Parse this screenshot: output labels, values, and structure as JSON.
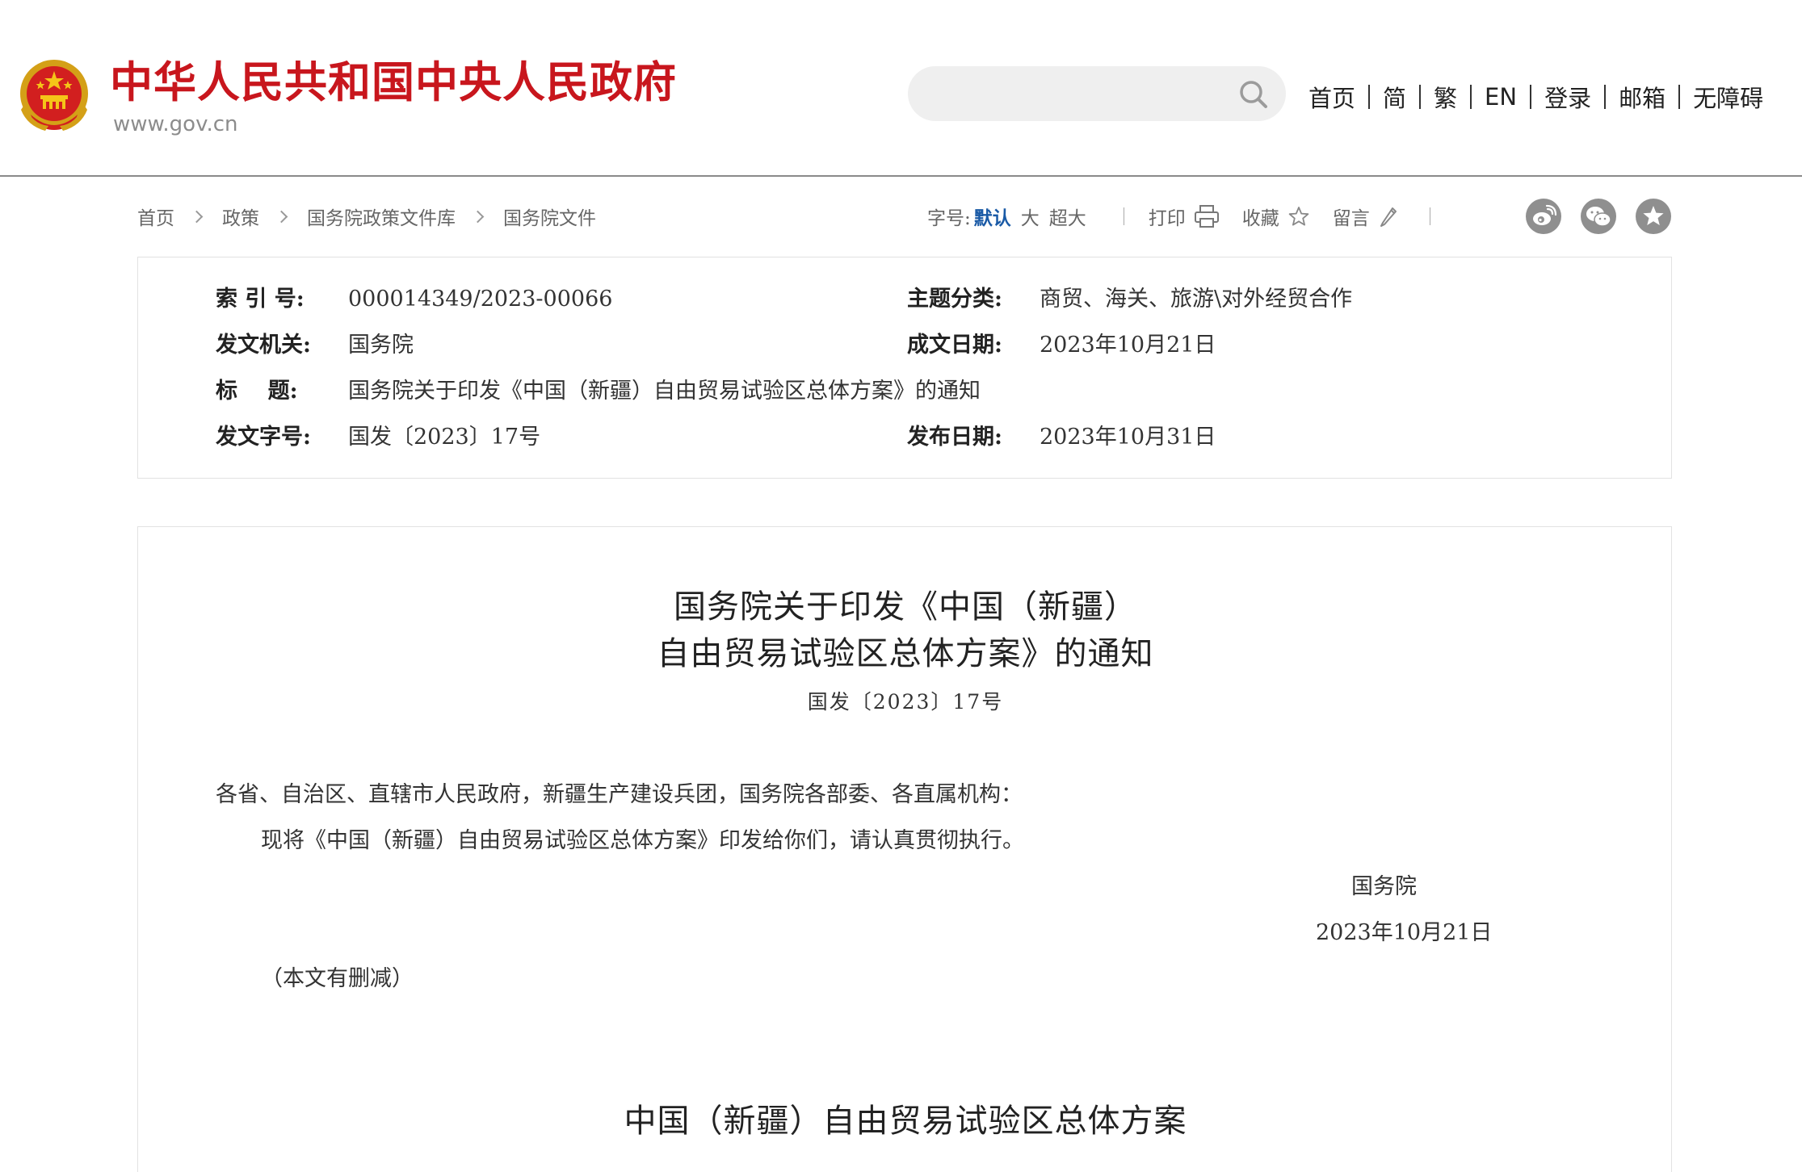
{
  "header": {
    "site_title": "中华人民共和国中央人民政府",
    "site_url": "www.gov.cn",
    "search_placeholder": "",
    "nav": [
      "首页",
      "简",
      "繁",
      "EN",
      "登录",
      "邮箱",
      "无障碍"
    ],
    "brand_color": "#c8161d"
  },
  "breadcrumb": [
    "首页",
    "政策",
    "国务院政策文件库",
    "国务院文件"
  ],
  "toolbar": {
    "font_size_label": "字号:",
    "font_size_options": [
      "默认",
      "大",
      "超大"
    ],
    "print": "打印",
    "favorite": "收藏",
    "comment": "留言",
    "share_icons": [
      "weibo-icon",
      "wechat-icon",
      "star-icon"
    ]
  },
  "info": {
    "index_no": {
      "label": "索 引 号:",
      "value": "000014349/2023-00066"
    },
    "issuer": {
      "label": "发文机关:",
      "value": "国务院"
    },
    "title": {
      "label": "标    题:",
      "value": "国务院关于印发《中国（新疆）自由贸易试验区总体方案》的通知"
    },
    "doc_no": {
      "label": "发文字号:",
      "value": "国发〔2023〕17号"
    },
    "category": {
      "label": "主题分类:",
      "value": "商贸、海关、旅游\\对外经贸合作"
    },
    "written_date": {
      "label": "成文日期:",
      "value": "2023年10月21日"
    },
    "publish_date": {
      "label": "发布日期:",
      "value": "2023年10月31日"
    }
  },
  "article": {
    "title_line1": "国务院关于印发《中国（新疆）",
    "title_line2": "自由贸易试验区总体方案》的通知",
    "doc_no": "国发〔2023〕17号",
    "salutation": "各省、自治区、直辖市人民政府，新疆生产建设兵团，国务院各部委、各直属机构：",
    "body": "现将《中国（新疆）自由贸易试验区总体方案》印发给你们，请认真贯彻执行。",
    "signature": "国务院",
    "sign_date": "2023年10月21日",
    "note": "（本文有删减）",
    "section_heading": "中国（新疆）自由贸易试验区总体方案"
  },
  "colors": {
    "active_font_option": "#1a5aa6",
    "share_icon_bg": "#8f8f8f"
  }
}
